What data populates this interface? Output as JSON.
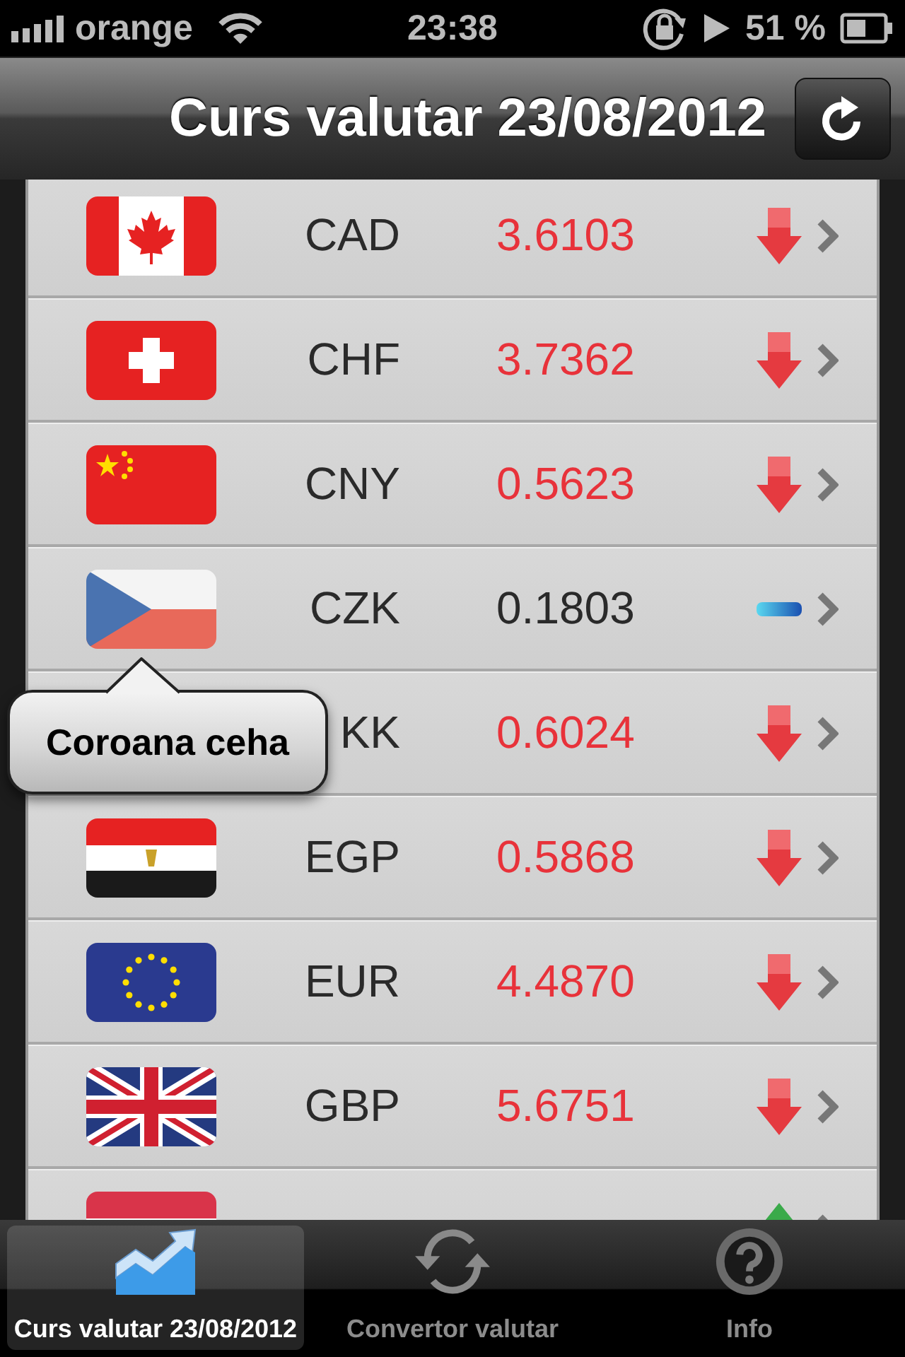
{
  "status_bar": {
    "carrier": "orange",
    "time": "23:38",
    "battery": "51 %"
  },
  "nav_bar": {
    "title": "Curs valutar 23/08/2012"
  },
  "rows": [
    {
      "code": "CAD",
      "rate": "3.6103",
      "kind": "down"
    },
    {
      "code": "CHF",
      "rate": "3.7362",
      "kind": "down"
    },
    {
      "code": "CNY",
      "rate": "0.5623",
      "kind": "down"
    },
    {
      "code": "CZK",
      "rate": "0.1803",
      "kind": "flat"
    },
    {
      "code": "KK",
      "rate": "0.6024",
      "kind": "down"
    },
    {
      "code": "EGP",
      "rate": "0.5868",
      "kind": "down"
    },
    {
      "code": "EUR",
      "rate": "4.4870",
      "kind": "down"
    },
    {
      "code": "GBP",
      "rate": "5.6751",
      "kind": "down"
    },
    {
      "kind": "up"
    }
  ],
  "tooltip": {
    "text": "Coroana ceha"
  },
  "tabs": [
    {
      "label": "Curs valutar 23/08/2012",
      "selected": true
    },
    {
      "label": "Convertor valutar",
      "selected": false
    },
    {
      "label": "Info",
      "selected": false
    }
  ]
}
